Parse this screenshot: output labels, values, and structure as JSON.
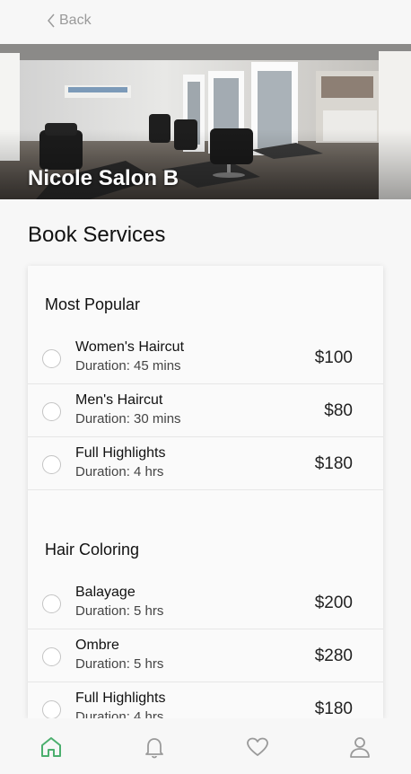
{
  "header": {
    "back_label": "Back"
  },
  "hero": {
    "salon_name": "Nicole Salon B"
  },
  "page": {
    "section_title": "Book Services"
  },
  "groups": [
    {
      "title": "Most Popular",
      "services": [
        {
          "name": "Women's Haircut",
          "duration": "Duration: 45 mins",
          "price": "$100"
        },
        {
          "name": "Men's Haircut",
          "duration": "Duration: 30 mins",
          "price": "$80"
        },
        {
          "name": "Full Highlights",
          "duration": "Duration: 4 hrs",
          "price": "$180"
        }
      ]
    },
    {
      "title": "Hair Coloring",
      "services": [
        {
          "name": "Balayage",
          "duration": "Duration: 5 hrs",
          "price": "$200"
        },
        {
          "name": "Ombre",
          "duration": "Duration: 5 hrs",
          "price": "$280"
        },
        {
          "name": "Full Highlights",
          "duration": "Duration: 4 hrs",
          "price": "$180"
        }
      ]
    }
  ],
  "tabbar": {
    "items": [
      "home-icon",
      "bell-icon",
      "heart-icon",
      "user-icon"
    ],
    "active": "home-icon",
    "active_color": "#4caf6e",
    "inactive_color": "#9a9a9a"
  }
}
